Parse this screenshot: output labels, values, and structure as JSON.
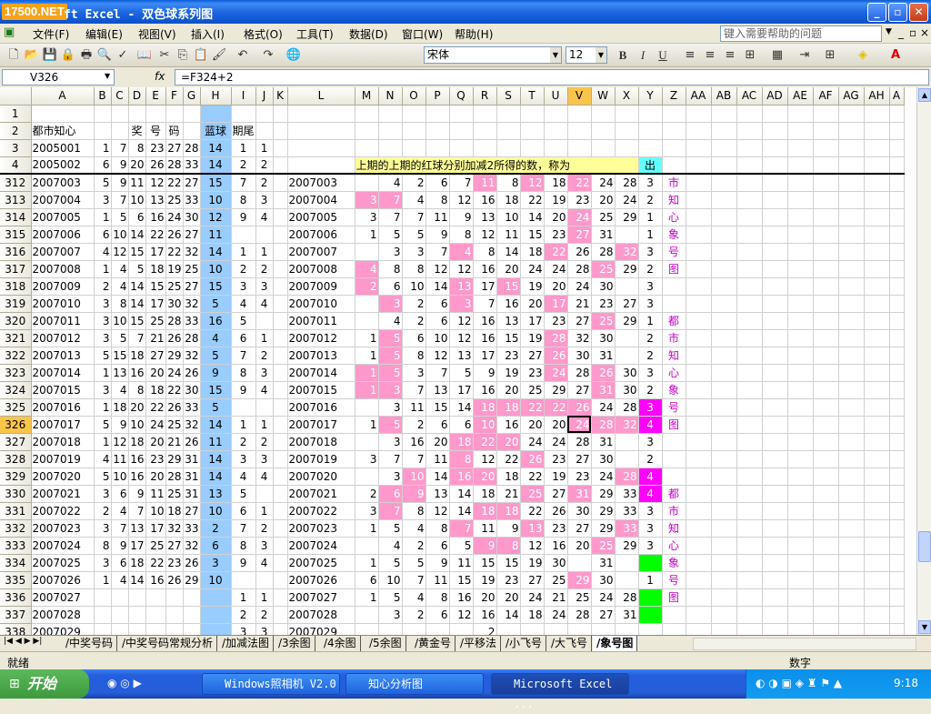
{
  "window": {
    "logo": "17500.NET",
    "title": "ft Excel - 双色球系列图"
  },
  "menu": [
    "文件(F)",
    "编辑(E)",
    "视图(V)",
    "插入(I)",
    "格式(O)",
    "工具(T)",
    "数据(D)",
    "窗口(W)",
    "帮助(H)"
  ],
  "help_placeholder": "键入需要帮助的问题",
  "toolbar": {
    "font": "宋体",
    "size": "12",
    "bold": "B",
    "italic": "I",
    "underline": "U"
  },
  "formula_bar": {
    "cell": "V326",
    "fx": "fx",
    "formula": "=F324+2"
  },
  "col_headers": [
    "A",
    "B",
    "C",
    "D",
    "E",
    "F",
    "G",
    "H",
    "I",
    "J",
    "K",
    "L",
    "M",
    "N",
    "O",
    "P",
    "Q",
    "R",
    "S",
    "T",
    "U",
    "V",
    "W",
    "X",
    "Y",
    "Z",
    "AA",
    "AB",
    "AC",
    "AD",
    "AE",
    "AF",
    "AG",
    "AH",
    "A"
  ],
  "selected_col": "V",
  "selected_row": "326",
  "row2": {
    "A": "都市知心",
    "D": "奖",
    "E": "号",
    "F": "码",
    "H": "蓝球",
    "I": "期尾"
  },
  "row4_note": "上期的上期的红球分别加减2所得的数，称为",
  "row4_tag": "出",
  "rows": [
    {
      "r": "1",
      "a": "",
      "red": [
        "",
        "",
        "",
        "",
        "",
        ""
      ],
      "blue": "",
      "i": "",
      "j": "",
      "l": "",
      "m": [],
      "y": "",
      "z": ""
    },
    {
      "r": "3",
      "a": "2005001",
      "red": [
        "1",
        "7",
        "8",
        "23",
        "27",
        "28"
      ],
      "blue": "14",
      "i": "1",
      "j": "1",
      "l": "",
      "m": [],
      "y": "",
      "z": ""
    },
    {
      "r": "4",
      "a": "2005002",
      "red": [
        "6",
        "9",
        "20",
        "26",
        "28",
        "33"
      ],
      "blue": "14",
      "i": "2",
      "j": "2",
      "l": "",
      "m": [],
      "y": "",
      "z": ""
    },
    {
      "r": "312",
      "a": "2007003",
      "red": [
        "5",
        "9",
        "11",
        "12",
        "22",
        "27"
      ],
      "blue": "15",
      "i": "7",
      "j": "2",
      "l": "2007003",
      "m": [
        "",
        "4",
        "2",
        "6",
        "7",
        "11",
        "8",
        "12",
        "18",
        "22",
        "24",
        "28"
      ],
      "y": "3",
      "z": "市"
    },
    {
      "r": "313",
      "a": "2007004",
      "red": [
        "3",
        "7",
        "10",
        "13",
        "25",
        "33"
      ],
      "blue": "10",
      "i": "8",
      "j": "3",
      "l": "2007004",
      "m": [
        "3",
        "7",
        "4",
        "8",
        "12",
        "16",
        "18",
        "22",
        "19",
        "23",
        "20",
        "24"
      ],
      "y": "2",
      "z": "知"
    },
    {
      "r": "314",
      "a": "2007005",
      "red": [
        "1",
        "5",
        "6",
        "16",
        "24",
        "30"
      ],
      "blue": "12",
      "i": "9",
      "j": "4",
      "l": "2007005",
      "m": [
        "3",
        "7",
        "7",
        "11",
        "9",
        "13",
        "10",
        "14",
        "20",
        "24",
        "25",
        "29"
      ],
      "y": "1",
      "z": "心"
    },
    {
      "r": "315",
      "a": "2007006",
      "red": [
        "6",
        "10",
        "14",
        "22",
        "26",
        "27"
      ],
      "blue": "11",
      "i": "",
      "j": "",
      "l": "2007006",
      "m": [
        "1",
        "5",
        "5",
        "9",
        "8",
        "12",
        "11",
        "15",
        "23",
        "27",
        "31",
        ""
      ],
      "y": "1",
      "z": "象"
    },
    {
      "r": "316",
      "a": "2007007",
      "red": [
        "4",
        "12",
        "15",
        "17",
        "22",
        "32"
      ],
      "blue": "14",
      "i": "1",
      "j": "1",
      "l": "2007007",
      "m": [
        "",
        "3",
        "3",
        "7",
        "4",
        "8",
        "14",
        "18",
        "22",
        "26",
        "28",
        "32"
      ],
      "y": "3",
      "z": "号"
    },
    {
      "r": "317",
      "a": "2007008",
      "red": [
        "1",
        "4",
        "5",
        "18",
        "19",
        "25"
      ],
      "blue": "10",
      "i": "2",
      "j": "2",
      "l": "2007008",
      "m": [
        "4",
        "8",
        "8",
        "12",
        "12",
        "16",
        "20",
        "24",
        "24",
        "28",
        "25",
        "29"
      ],
      "y": "2",
      "z": "图"
    },
    {
      "r": "318",
      "a": "2007009",
      "red": [
        "2",
        "4",
        "14",
        "15",
        "25",
        "27"
      ],
      "blue": "15",
      "i": "3",
      "j": "3",
      "l": "2007009",
      "m": [
        "2",
        "6",
        "10",
        "14",
        "13",
        "17",
        "15",
        "19",
        "20",
        "24",
        "30",
        ""
      ],
      "y": "3",
      "z": ""
    },
    {
      "r": "319",
      "a": "2007010",
      "red": [
        "3",
        "8",
        "14",
        "17",
        "30",
        "32"
      ],
      "blue": "5",
      "i": "4",
      "j": "4",
      "l": "2007010",
      "m": [
        "",
        "3",
        "2",
        "6",
        "3",
        "7",
        "16",
        "20",
        "17",
        "21",
        "23",
        "27"
      ],
      "y": "3",
      "z": ""
    },
    {
      "r": "320",
      "a": "2007011",
      "red": [
        "3",
        "10",
        "15",
        "25",
        "28",
        "33"
      ],
      "blue": "16",
      "i": "5",
      "j": "",
      "l": "2007011",
      "m": [
        "",
        "4",
        "2",
        "6",
        "12",
        "16",
        "13",
        "17",
        "23",
        "27",
        "25",
        "29"
      ],
      "y": "1",
      "z": "都"
    },
    {
      "r": "321",
      "a": "2007012",
      "red": [
        "3",
        "5",
        "7",
        "21",
        "26",
        "28"
      ],
      "blue": "4",
      "i": "6",
      "j": "1",
      "l": "2007012",
      "m": [
        "1",
        "5",
        "6",
        "10",
        "12",
        "16",
        "15",
        "19",
        "28",
        "32",
        "30",
        ""
      ],
      "y": "2",
      "z": "市"
    },
    {
      "r": "322",
      "a": "2007013",
      "red": [
        "5",
        "15",
        "18",
        "27",
        "29",
        "32"
      ],
      "blue": "5",
      "i": "7",
      "j": "2",
      "l": "2007013",
      "m": [
        "1",
        "5",
        "8",
        "12",
        "13",
        "17",
        "23",
        "27",
        "26",
        "30",
        "31",
        ""
      ],
      "y": "2",
      "z": "知"
    },
    {
      "r": "323",
      "a": "2007014",
      "red": [
        "1",
        "13",
        "16",
        "20",
        "24",
        "26"
      ],
      "blue": "9",
      "i": "8",
      "j": "3",
      "l": "2007014",
      "m": [
        "1",
        "5",
        "3",
        "7",
        "5",
        "9",
        "19",
        "23",
        "24",
        "28",
        "26",
        "30"
      ],
      "y": "3",
      "z": "心"
    },
    {
      "r": "324",
      "a": "2007015",
      "red": [
        "3",
        "4",
        "8",
        "18",
        "22",
        "30"
      ],
      "blue": "15",
      "i": "9",
      "j": "4",
      "l": "2007015",
      "m": [
        "1",
        "3",
        "7",
        "13",
        "17",
        "16",
        "20",
        "25",
        "29",
        "27",
        "31",
        "30"
      ],
      "y": "2",
      "z": "象"
    },
    {
      "r": "325",
      "a": "2007016",
      "red": [
        "1",
        "18",
        "20",
        "22",
        "26",
        "33"
      ],
      "blue": "5",
      "i": "",
      "j": "",
      "l": "2007016",
      "m": [
        "",
        "3",
        "11",
        "15",
        "14",
        "18",
        "18",
        "22",
        "22",
        "26",
        "24",
        "28"
      ],
      "y": "3",
      "z": "号"
    },
    {
      "r": "326",
      "a": "2007017",
      "red": [
        "5",
        "9",
        "10",
        "24",
        "25",
        "32"
      ],
      "blue": "14",
      "i": "1",
      "j": "1",
      "l": "2007017",
      "m": [
        "1",
        "5",
        "2",
        "6",
        "6",
        "10",
        "16",
        "20",
        "20",
        "24",
        "28",
        "32"
      ],
      "y": "4",
      "z": "图"
    },
    {
      "r": "327",
      "a": "2007018",
      "red": [
        "1",
        "12",
        "18",
        "20",
        "21",
        "26"
      ],
      "blue": "11",
      "i": "2",
      "j": "2",
      "l": "2007018",
      "m": [
        "",
        "3",
        "16",
        "20",
        "18",
        "22",
        "20",
        "24",
        "24",
        "28",
        "31",
        ""
      ],
      "y": "3",
      "z": ""
    },
    {
      "r": "328",
      "a": "2007019",
      "red": [
        "4",
        "11",
        "16",
        "23",
        "29",
        "31"
      ],
      "blue": "14",
      "i": "3",
      "j": "3",
      "l": "2007019",
      "m": [
        "3",
        "7",
        "7",
        "11",
        "8",
        "12",
        "22",
        "26",
        "23",
        "27",
        "30",
        ""
      ],
      "y": "2",
      "z": ""
    },
    {
      "r": "329",
      "a": "2007020",
      "red": [
        "5",
        "10",
        "16",
        "20",
        "28",
        "31"
      ],
      "blue": "14",
      "i": "4",
      "j": "4",
      "l": "2007020",
      "m": [
        "",
        "3",
        "10",
        "14",
        "16",
        "20",
        "18",
        "22",
        "19",
        "23",
        "24",
        "28"
      ],
      "y": "4",
      "z": ""
    },
    {
      "r": "330",
      "a": "2007021",
      "red": [
        "3",
        "6",
        "9",
        "11",
        "25",
        "31"
      ],
      "blue": "13",
      "i": "5",
      "j": "",
      "l": "2007021",
      "m": [
        "2",
        "6",
        "9",
        "13",
        "14",
        "18",
        "21",
        "25",
        "27",
        "31",
        "29",
        "33"
      ],
      "y": "4",
      "z": "都"
    },
    {
      "r": "331",
      "a": "2007022",
      "red": [
        "2",
        "4",
        "7",
        "10",
        "18",
        "27"
      ],
      "blue": "10",
      "i": "6",
      "j": "1",
      "l": "2007022",
      "m": [
        "3",
        "7",
        "8",
        "12",
        "14",
        "18",
        "18",
        "22",
        "26",
        "30",
        "29",
        "33"
      ],
      "y": "3",
      "z": "市"
    },
    {
      "r": "332",
      "a": "2007023",
      "red": [
        "3",
        "7",
        "13",
        "17",
        "32",
        "33"
      ],
      "blue": "2",
      "i": "7",
      "j": "2",
      "l": "2007023",
      "m": [
        "1",
        "5",
        "4",
        "8",
        "7",
        "11",
        "9",
        "13",
        "23",
        "27",
        "29",
        "33"
      ],
      "y": "3",
      "z": "知"
    },
    {
      "r": "333",
      "a": "2007024",
      "red": [
        "8",
        "9",
        "17",
        "25",
        "27",
        "32"
      ],
      "blue": "6",
      "i": "8",
      "j": "3",
      "l": "2007024",
      "m": [
        "",
        "4",
        "2",
        "6",
        "5",
        "9",
        "8",
        "12",
        "16",
        "20",
        "25",
        "29"
      ],
      "y": "3",
      "z": "心"
    },
    {
      "r": "334",
      "a": "2007025",
      "red": [
        "3",
        "6",
        "18",
        "22",
        "23",
        "26"
      ],
      "blue": "3",
      "i": "9",
      "j": "4",
      "l": "2007025",
      "m": [
        "1",
        "5",
        "5",
        "9",
        "11",
        "15",
        "15",
        "19",
        "30",
        "",
        "31",
        ""
      ],
      "y": "",
      "z": "象"
    },
    {
      "r": "335",
      "a": "2007026",
      "red": [
        "1",
        "4",
        "14",
        "16",
        "26",
        "29"
      ],
      "blue": "10",
      "i": "",
      "j": "",
      "l": "2007026",
      "m": [
        "6",
        "10",
        "7",
        "11",
        "15",
        "19",
        "23",
        "27",
        "25",
        "29",
        "30",
        ""
      ],
      "y": "1",
      "z": "号"
    },
    {
      "r": "336",
      "a": "2007027",
      "red": [
        "",
        "",
        "",
        "",
        "",
        ""
      ],
      "blue": "",
      "i": "1",
      "j": "1",
      "l": "2007027",
      "m": [
        "1",
        "5",
        "4",
        "8",
        "16",
        "20",
        "20",
        "24",
        "21",
        "25",
        "24",
        "28"
      ],
      "y": "",
      "z": "图"
    },
    {
      "r": "337",
      "a": "2007028",
      "red": [
        "",
        "",
        "",
        "",
        "",
        ""
      ],
      "blue": "",
      "i": "2",
      "j": "2",
      "l": "2007028",
      "m": [
        "",
        "3",
        "2",
        "6",
        "12",
        "16",
        "14",
        "18",
        "24",
        "28",
        "27",
        "31"
      ],
      "y": "",
      "z": ""
    },
    {
      "r": "338",
      "a": "2007029",
      "red": [
        "",
        "",
        "",
        "",
        "",
        ""
      ],
      "blue": "",
      "i": "3",
      "j": "3",
      "l": "2007029",
      "m": [
        "",
        "",
        "",
        "",
        "",
        "2",
        "",
        "",
        "",
        "",
        "",
        ""
      ],
      "y": "",
      "z": ""
    }
  ],
  "sheet_tabs": [
    "中奖号码",
    "中奖号码常规分析",
    "加减法图",
    "3余图",
    "4余图",
    "5余图",
    "黄金号",
    "平移法",
    "小飞号",
    "大飞号",
    "象号图"
  ],
  "status": {
    "left": "就绪",
    "right": "数字"
  },
  "taskbar": {
    "start": "开始",
    "tasks": [
      "Windows照相机 V2.0",
      "知心分析图",
      "Microsoft Excel ..."
    ],
    "clock": "9:18"
  }
}
